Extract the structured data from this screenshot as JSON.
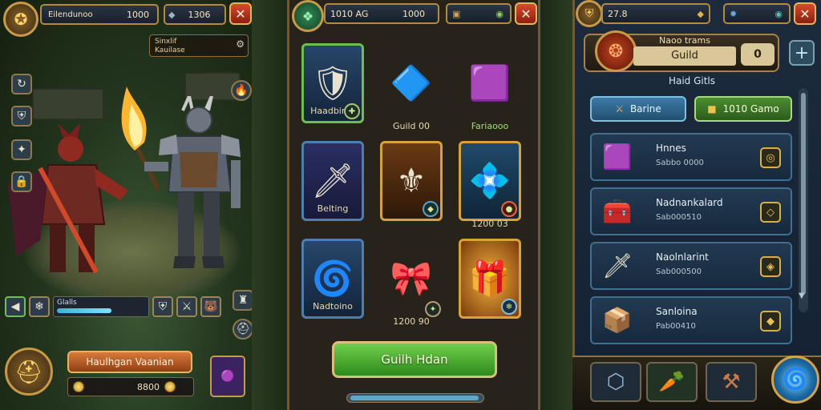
{
  "left_panel": {
    "player_name": "Eilendunoo",
    "player_gold": "1000",
    "gems": "1306",
    "quest_title": "Sinxlif",
    "quest_text": "Kauilase",
    "xp_label": "Glalls",
    "hero_name_button": "Haulhgan Vaanian",
    "gold_amount": "8800"
  },
  "middle_panel": {
    "top_value_a": "1010 AG",
    "top_value_b": "1000",
    "items": [
      {
        "label": "Haadbirse",
        "art": "🛡"
      },
      {
        "label": "Guild 00",
        "art": "🔷"
      },
      {
        "label": "Fariaooo",
        "art": "🟪"
      },
      {
        "label": "Belting",
        "art": "🗡"
      },
      {
        "label": "",
        "art": "⚜"
      },
      {
        "label": "1200 03",
        "art": "💠"
      },
      {
        "label": "Nadtoino",
        "art": "🌀"
      },
      {
        "label": "1200 90",
        "art": "🎀"
      },
      {
        "label": "",
        "art": "🎁"
      }
    ],
    "guild_button": "Guilh Hdan"
  },
  "right_panel": {
    "top_value": "27.8",
    "guild_title": "Naoo trams",
    "guild_name": "Guild",
    "guild_count": "0",
    "section_title": "Haid Gitls",
    "tab_a": "Barine",
    "tab_b": "1010 Gamo",
    "rows": [
      {
        "name": "Hnnes",
        "sub": "Sabbo 0000",
        "art": "🟪"
      },
      {
        "name": "Nadnankalard",
        "sub": "Sab000510",
        "art": "🧰"
      },
      {
        "name": "Naolnlarint",
        "sub": "Sab000500",
        "art": "🗡"
      },
      {
        "name": "Sanloina",
        "sub": "Pab00410",
        "art": "📦"
      }
    ]
  },
  "colors": {
    "accent_gold": "#d7a13c",
    "accent_green": "#6fd04a",
    "close_red": "#d64a2d"
  },
  "progress": {
    "xp_fraction": 0.62
  }
}
